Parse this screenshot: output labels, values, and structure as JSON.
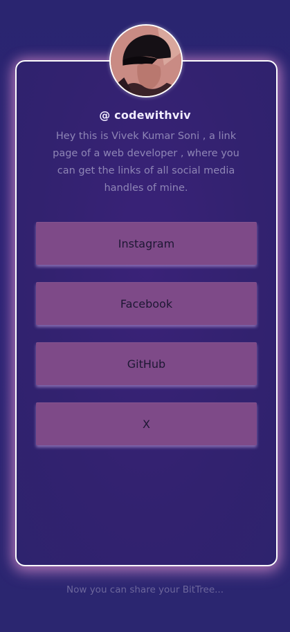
{
  "profile": {
    "handle": "@ codewithviv",
    "bio": "Hey this is Vivek Kumar Soni , a link page of a web developer , where you can get the links of all social media handles of mine."
  },
  "links": [
    {
      "label": "Instagram"
    },
    {
      "label": "Facebook"
    },
    {
      "label": "GitHub"
    },
    {
      "label": "X"
    }
  ],
  "footer": {
    "text": "Now you can share your BitTree..."
  },
  "colors": {
    "background": "#2d2375",
    "card_border": "#ffffff",
    "card_glow": "#ffa8e0",
    "button_bg": "#7e4a88",
    "button_text": "#1d1733",
    "bio_text": "#8f86b6",
    "footer_text": "#6d679c"
  }
}
